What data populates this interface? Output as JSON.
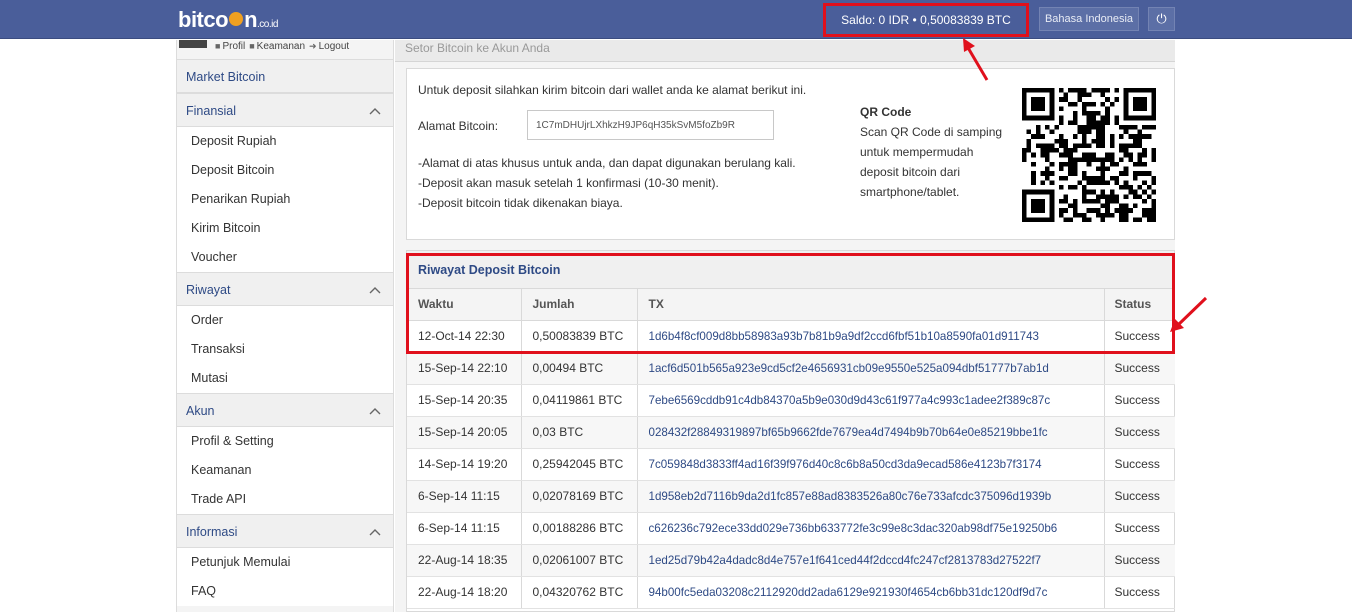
{
  "navbar": {
    "logo_main": "bitco",
    "logo_end": "n",
    "logo_tld": ".co.id",
    "saldo_text": "Saldo:  0 IDR  •  0,50083839 BTC",
    "lang_button": "Bahasa Indonesia",
    "power_icon": "⏻"
  },
  "user_bar": {
    "profil": "Profil",
    "keamanan": "Keamanan",
    "logout": "Logout"
  },
  "sidebar": {
    "market": "Market Bitcoin",
    "sections": [
      {
        "title": "Finansial",
        "items": [
          "Deposit Rupiah",
          "Deposit Bitcoin",
          "Penarikan Rupiah",
          "Kirim Bitcoin",
          "Voucher"
        ]
      },
      {
        "title": "Riwayat",
        "items": [
          "Order",
          "Transaksi",
          "Mutasi"
        ]
      },
      {
        "title": "Akun",
        "items": [
          "Profil & Setting",
          "Keamanan",
          "Trade API"
        ]
      },
      {
        "title": "Informasi",
        "items": [
          "Petunjuk Memulai",
          "FAQ"
        ]
      }
    ]
  },
  "main": {
    "breadcrumb": "Setor Bitcoin ke Akun Anda",
    "intro": "Untuk deposit silahkan kirim bitcoin dari wallet anda ke alamat berikut ini.",
    "address_label": "Alamat Bitcoin:",
    "address_value": "1C7mDHUjrLXhkzH9JP6qH35kSvM5foZb9R",
    "notes": [
      "-Alamat di atas khusus untuk anda, dan dapat digunakan berulang kali.",
      "-Deposit akan masuk setelah 1 konfirmasi (10-30 menit).",
      "-Deposit bitcoin tidak dikenakan biaya."
    ],
    "qr_title": "QR Code",
    "qr_lines": [
      "Scan QR Code di samping",
      "untuk mempermudah",
      "deposit bitcoin dari",
      "smartphone/tablet."
    ]
  },
  "history": {
    "title": "Riwayat Deposit Bitcoin",
    "columns": [
      "Waktu",
      "Jumlah",
      "TX",
      "Status"
    ],
    "rows": [
      [
        "12-Oct-14 22:30",
        "0,50083839 BTC",
        "1d6b4f8cf009d8bb58983a93b7b81b9a9df2ccd6fbf51b10a8590fa01d911743",
        "Success"
      ],
      [
        "15-Sep-14 22:10",
        "0,00494 BTC",
        "1acf6d501b565a923e9cd5cf2e4656931cb09e9550e525a094dbf51777b7ab1d",
        "Success"
      ],
      [
        "15-Sep-14 20:35",
        "0,04119861 BTC",
        "7ebe6569cddb91c4db84370a5b9e030d9d43c61f977a4c993c1adee2f389c87c",
        "Success"
      ],
      [
        "15-Sep-14 20:05",
        "0,03 BTC",
        "028432f28849319897bf65b9662fde7679ea4d7494b9b70b64e0e85219bbe1fc",
        "Success"
      ],
      [
        "14-Sep-14 19:20",
        "0,25942045 BTC",
        "7c059848d3833ff4ad16f39f976d40c8c6b8a50cd3da9ecad586e4123b7f3174",
        "Success"
      ],
      [
        "6-Sep-14 11:15",
        "0,02078169 BTC",
        "1d958eb2d7116b9da2d1fc857e88ad8383526a80c76e733afcdc375096d1939b",
        "Success"
      ],
      [
        "6-Sep-14 11:15",
        "0,00188286 BTC",
        "c626236c792ece33dd029e736bb633772fe3c99e8c3dac320ab98df75e19250b6",
        "Success"
      ],
      [
        "22-Aug-14 18:35",
        "0,02061007 BTC",
        "1ed25d79b42a4dadc8d4e757e1f641ced44f2dccd4fc247cf2813783d27522f7",
        "Success"
      ],
      [
        "22-Aug-14 18:20",
        "0,04320762 BTC",
        "94b00fc5eda03208c2112920dd2ada6129e921930f4654cb6bb31dc120df9d7c",
        "Success"
      ]
    ]
  },
  "colors": {
    "navbar": "#4a5e9a",
    "highlight": "#e0101c",
    "link": "#2e4a85"
  }
}
